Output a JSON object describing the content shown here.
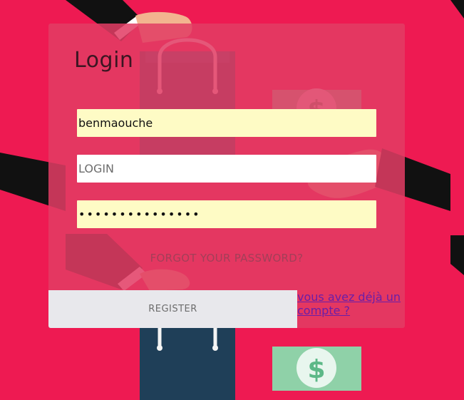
{
  "login_form": {
    "title": "Login",
    "username_value": "benmaouche",
    "login_placeholder": "LOGIN",
    "password_value": "•••••••••••••••",
    "forgot_password_label": "FORGOT YOUR PASSWORD?",
    "register_label": "REGISTER",
    "have_account_link": "vous avez déjà un compte ?"
  },
  "colors": {
    "background": "#ee1a52",
    "card": "#e23c64",
    "autofill_field": "#fefbc5",
    "register_button": "#e8e8ec",
    "link": "#6a1ea8"
  },
  "icons": [
    "shopping-bag-icon",
    "dollar-bill-icon",
    "hand-icon"
  ]
}
